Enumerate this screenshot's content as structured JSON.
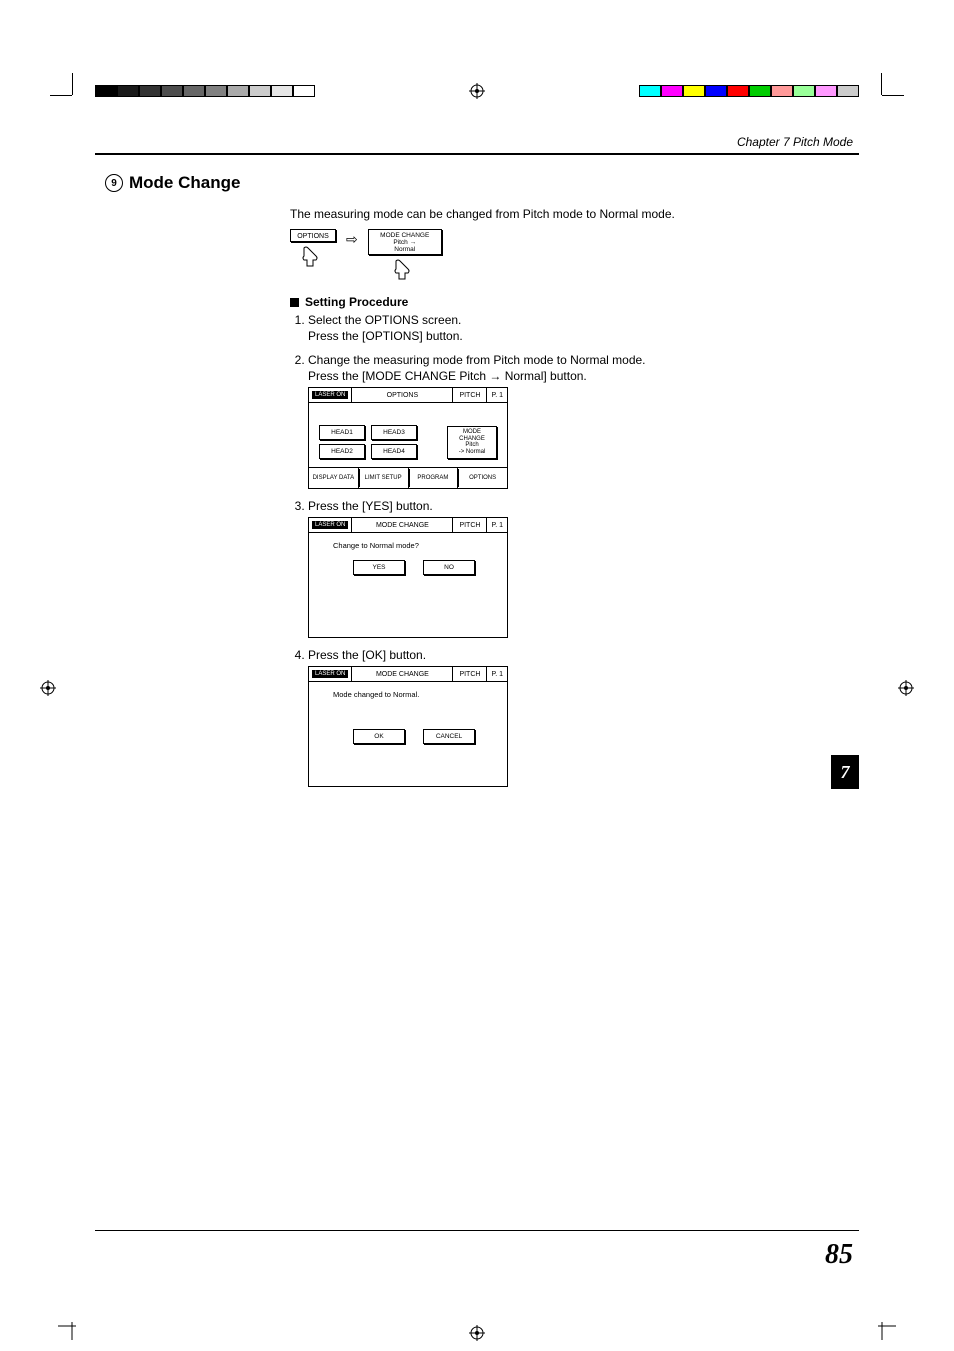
{
  "running_head": "Chapter 7    Pitch Mode",
  "section_number": "9",
  "section_title": "Mode Change",
  "intro": "The measuring mode can be changed from Pitch mode to Normal mode.",
  "flow": {
    "btn1": "OPTIONS",
    "btn2_line1": "MODE CHANGE",
    "btn2_line2": "Pitch →",
    "btn2_line3": "Normal"
  },
  "procedure_heading": "Setting Procedure",
  "steps": [
    {
      "lead": "Select the OPTIONS screen.",
      "sub": "Press the [OPTIONS] button."
    },
    {
      "lead": "Change the measuring mode from Pitch mode to Normal mode.",
      "sub": "Press the [MODE CHANGE Pitch → Normal] button."
    },
    {
      "lead": "Press the [YES] button."
    },
    {
      "lead": "Press the [OK] button."
    }
  ],
  "options_screen": {
    "laser": "LASER ON",
    "title": "OPTIONS",
    "mode": "PITCH",
    "page": "P. 1",
    "heads": [
      "HEAD1",
      "HEAD2",
      "HEAD3",
      "HEAD4"
    ],
    "mode_box_l1": "MODE",
    "mode_box_l2": "CHANGE",
    "mode_box_l3": "Pitch",
    "mode_box_l4": "-> Normal",
    "tabs": [
      "DISPLAY\nDATA",
      "LIMIT\nSETUP",
      "PROGRAM",
      "OPTIONS"
    ]
  },
  "confirm_screen": {
    "laser": "LASER ON",
    "title": "MODE CHANGE",
    "mode": "PITCH",
    "page": "P. 1",
    "msg": "Change to Normal mode?",
    "yes": "YES",
    "no": "NO"
  },
  "done_screen": {
    "laser": "LASER ON",
    "title": "MODE CHANGE",
    "mode": "PITCH",
    "page": "P. 1",
    "msg": "Mode changed to Normal.",
    "ok": "OK",
    "cancel": "CANCEL"
  },
  "side_tab": "7",
  "page_number": "85"
}
